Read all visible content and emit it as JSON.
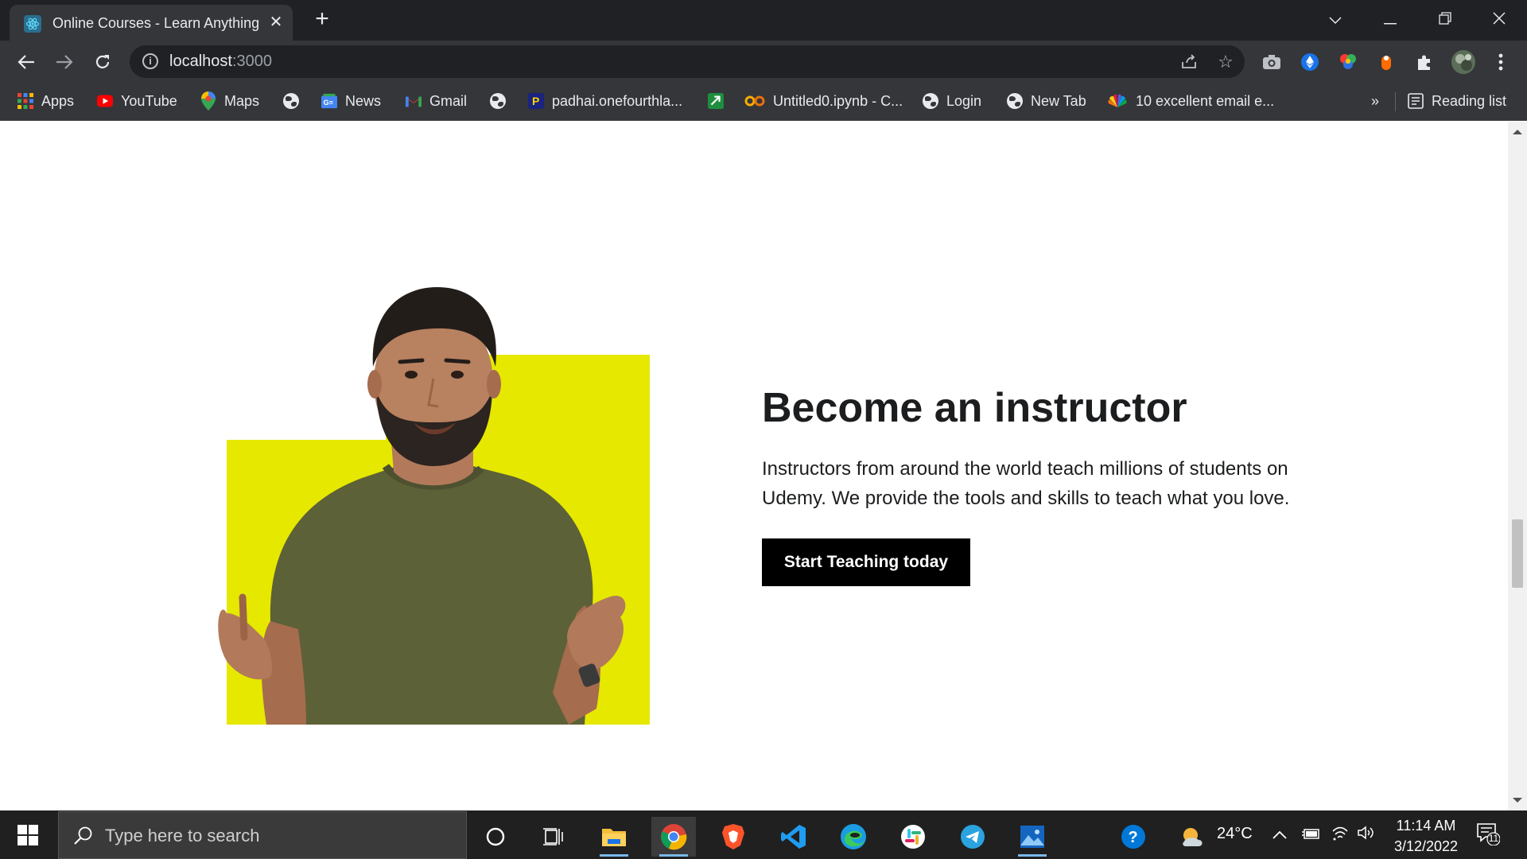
{
  "browser": {
    "tab_title": "Online Courses - Learn Anything",
    "url_host": "localhost",
    "url_port": ":3000",
    "reading_list_label": "Reading list",
    "bookmarks_overflow": "»",
    "bookmarks": [
      {
        "label": "Apps",
        "icon": "apps-grid-icon"
      },
      {
        "label": "YouTube",
        "icon": "youtube-icon"
      },
      {
        "label": "Maps",
        "icon": "maps-pin-icon"
      },
      {
        "label": "",
        "icon": "globe-icon"
      },
      {
        "label": "News",
        "icon": "google-news-icon"
      },
      {
        "label": "Gmail",
        "icon": "gmail-icon"
      },
      {
        "label": "",
        "icon": "globe-icon"
      },
      {
        "label": "padhai.onefourthla...",
        "icon": "padhai-icon"
      },
      {
        "label": "",
        "icon": "green-arrow-icon"
      },
      {
        "label": "Untitled0.ipynb - C...",
        "icon": "colab-icon"
      },
      {
        "label": "Login",
        "icon": "globe-icon"
      },
      {
        "label": "New Tab",
        "icon": "globe-icon"
      },
      {
        "label": "10 excellent email e...",
        "icon": "nbc-peacock-icon"
      }
    ]
  },
  "page": {
    "headline": "Become an instructor",
    "description": "Instructors from around the world teach millions of students on Udemy. We provide the tools and skills to teach what you love.",
    "cta_label": "Start Teaching today",
    "accent_color": "#e6e800"
  },
  "taskbar": {
    "search_placeholder": "Type here to search",
    "temperature": "24°C",
    "time": "11:14 AM",
    "date": "3/12/2022",
    "notification_count": "11"
  }
}
